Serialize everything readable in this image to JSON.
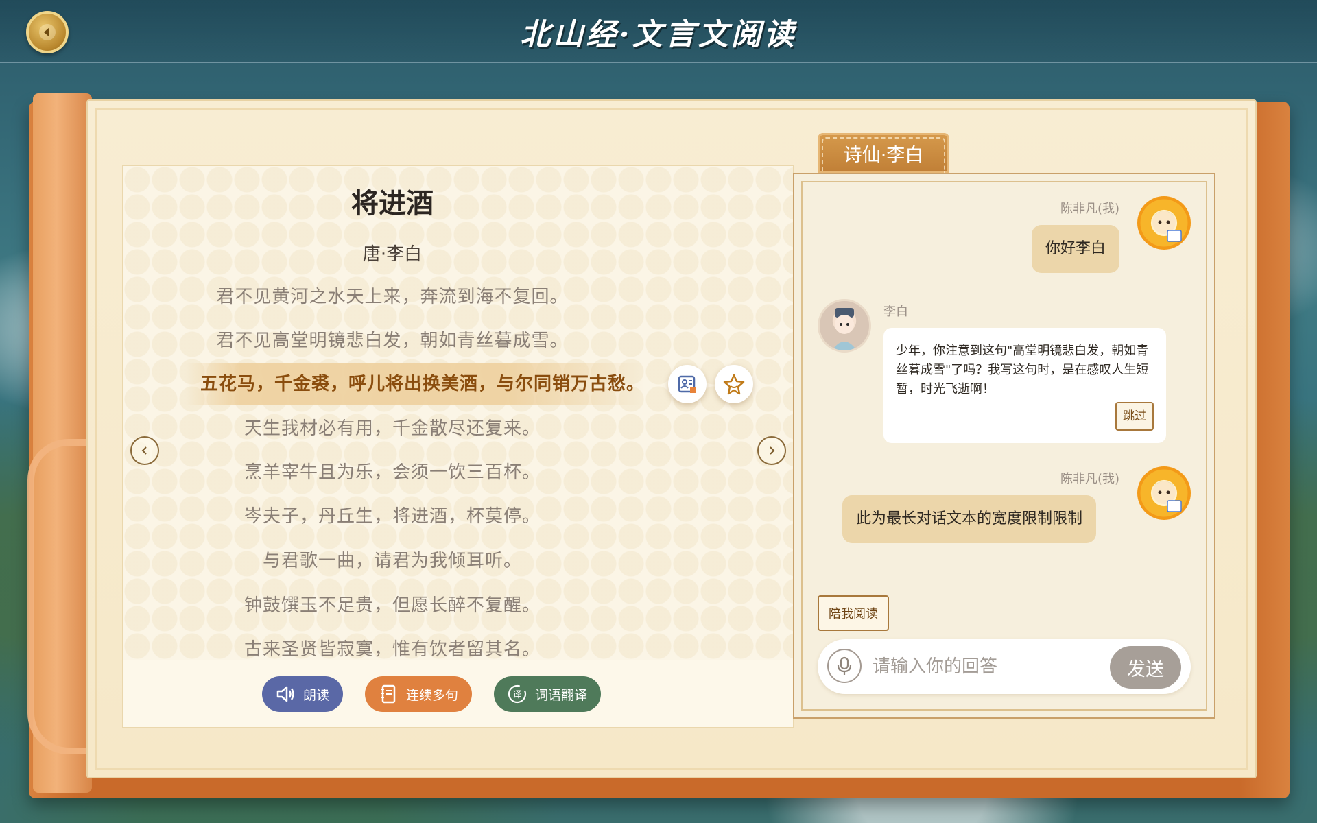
{
  "header": {
    "title": "北山经·文言文阅读"
  },
  "poem": {
    "title": "将进酒",
    "author": "唐·李白",
    "lines": [
      "君不见黄河之水天上来，奔流到海不复回。",
      "君不见高堂明镜悲白发，朝如青丝暮成雪。",
      "五花马，千金裘，呼儿将出换美酒，与尔同销万古愁。",
      "天生我材必有用，千金散尽还复来。",
      "烹羊宰牛且为乐，会须一饮三百杯。",
      "岑夫子，丹丘生，将进酒，杯莫停。",
      "与君歌一曲，请君为我倾耳听。",
      "钟鼓馔玉不足贵，但愿长醉不复醒。",
      "古来圣贤皆寂寞，惟有饮者留其名。"
    ],
    "active_line_index": 2
  },
  "toolbar": {
    "read_label": "朗读",
    "multi_label": "连续多句",
    "translate_label": "词语翻译",
    "colors": {
      "read": "#5a68a6",
      "multi": "#e0813f",
      "translate": "#4f7a5a"
    }
  },
  "chat": {
    "tab_label": "诗仙·李白",
    "messages": [
      {
        "from": "me",
        "sender": "陈非凡(我)",
        "text": "你好李白"
      },
      {
        "from": "ai",
        "sender": "李白",
        "text": "少年，你注意到这句\"高堂明镜悲白发，朝如青丝暮成雪\"了吗？我写这句时，是在感叹人生短暂，时光飞逝啊！",
        "skip_label": "跳过"
      },
      {
        "from": "me",
        "sender": "陈非凡(我)",
        "text": "此为最长对话文本的宽度限制限制"
      }
    ],
    "accompany_label": "陪我阅读",
    "input_placeholder": "请输入你的回答",
    "send_label": "发送"
  }
}
